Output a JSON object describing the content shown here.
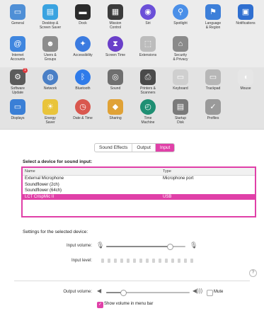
{
  "prefs": {
    "rows": [
      [
        {
          "label": "General",
          "icon": "general-icon",
          "color": "#4f8fd6",
          "glyph": "▭"
        },
        {
          "label": "Desktop &\nScreen Saver",
          "icon": "desktop-screen-saver-icon",
          "color": "#3aa3e0",
          "glyph": "▤"
        },
        {
          "label": "Dock",
          "icon": "dock-icon",
          "color": "#2b2b2b",
          "glyph": "▬"
        },
        {
          "label": "Mission\nControl",
          "icon": "mission-control-icon",
          "color": "#3b3b3b",
          "glyph": "▦"
        },
        {
          "label": "Siri",
          "icon": "siri-icon",
          "color": "#6b4fd8",
          "glyph": "◉"
        },
        {
          "label": "Spotlight",
          "icon": "spotlight-icon",
          "color": "#4a8fe8",
          "glyph": "⚲"
        },
        {
          "label": "Language\n& Region",
          "icon": "language-region-icon",
          "color": "#3d7fd9",
          "glyph": "⚑"
        },
        {
          "label": "Notifications",
          "icon": "notifications-icon",
          "color": "#2f6fd0",
          "glyph": "▣"
        }
      ],
      [
        {
          "label": "Internet\nAccounts",
          "icon": "internet-accounts-icon",
          "color": "#3f86df",
          "glyph": "@"
        },
        {
          "label": "Users &\nGroups",
          "icon": "users-groups-icon",
          "color": "#8d8d8d",
          "glyph": "☻"
        },
        {
          "label": "Accessibility",
          "icon": "accessibility-icon",
          "color": "#3b7be0",
          "glyph": "✦"
        },
        {
          "label": "Screen Time",
          "icon": "screen-time-icon",
          "color": "#6a3fc9",
          "glyph": "⧗"
        },
        {
          "label": "Extensions",
          "icon": "extensions-icon",
          "color": "#bcbcbc",
          "glyph": "⬚"
        },
        {
          "label": "Security\n& Privacy",
          "icon": "security-privacy-icon",
          "color": "#8a8a8a",
          "glyph": "⌂"
        }
      ],
      [
        {
          "label": "Software\nUpdate",
          "icon": "software-update-icon",
          "color": "#5b5b5b",
          "glyph": "⚙",
          "badge": "1"
        },
        {
          "label": "Network",
          "icon": "network-icon",
          "color": "#4a7fc6",
          "glyph": "◍"
        },
        {
          "label": "Bluetooth",
          "icon": "bluetooth-icon",
          "color": "#2f7bea",
          "glyph": "ᛒ"
        },
        {
          "label": "Sound",
          "icon": "sound-icon",
          "color": "#6f6f6f",
          "glyph": "◎"
        },
        {
          "label": "Printers &\nScanners",
          "icon": "printers-scanners-icon",
          "color": "#4a4a4a",
          "glyph": "⎙"
        },
        {
          "label": "Keyboard",
          "icon": "keyboard-icon",
          "color": "#cfcfcf",
          "glyph": "▭"
        },
        {
          "label": "Trackpad",
          "icon": "trackpad-icon",
          "color": "#b7b7b7",
          "glyph": "▭"
        },
        {
          "label": "Mouse",
          "icon": "mouse-icon",
          "color": "#e6e6e6",
          "glyph": "◖"
        }
      ],
      [
        {
          "label": "Displays",
          "icon": "displays-icon",
          "color": "#3a7fd6",
          "glyph": "▭"
        },
        {
          "label": "Energy\nSaver",
          "icon": "energy-saver-icon",
          "color": "#e9c43b",
          "glyph": "☀"
        },
        {
          "label": "Date & Time",
          "icon": "date-time-icon",
          "color": "#d9574e",
          "glyph": "◷"
        },
        {
          "label": "Sharing",
          "icon": "sharing-icon",
          "color": "#e0a236",
          "glyph": "◆"
        },
        {
          "label": "Time\nMachine",
          "icon": "time-machine-icon",
          "color": "#1f8f73",
          "glyph": "◴"
        },
        {
          "label": "Startup\nDisk",
          "icon": "startup-disk-icon",
          "color": "#7a7a7a",
          "glyph": "▤"
        },
        {
          "label": "Profiles",
          "icon": "profiles-icon",
          "color": "#9a9a9a",
          "glyph": "✓"
        }
      ]
    ]
  },
  "sound": {
    "tabs": [
      "Sound Effects",
      "Output",
      "Input"
    ],
    "active_tab": "Input",
    "select_title": "Select a device for sound input:",
    "columns": {
      "name": "Name",
      "type": "Type"
    },
    "devices": [
      {
        "name": "External Microphone",
        "type": "Microphone port"
      },
      {
        "name": "Soundflower (2ch)",
        "type": ""
      },
      {
        "name": "Soundflower (64ch)",
        "type": ""
      },
      {
        "name": "LCT CrispMic II",
        "type": "USB"
      }
    ],
    "selected_device": "LCT CrispMic II",
    "settings_label": "Settings for the selected device:",
    "input_volume_label": "Input volume:",
    "input_volume": 0.8,
    "input_level_label": "Input level:",
    "help": "?",
    "output_volume_label": "Output volume:",
    "output_volume": 0.2,
    "mute_label": "Mute",
    "mute_checked": false,
    "show_volume_label": "Show volume in menu bar",
    "show_volume_checked": true,
    "accent": "#e040a8"
  }
}
